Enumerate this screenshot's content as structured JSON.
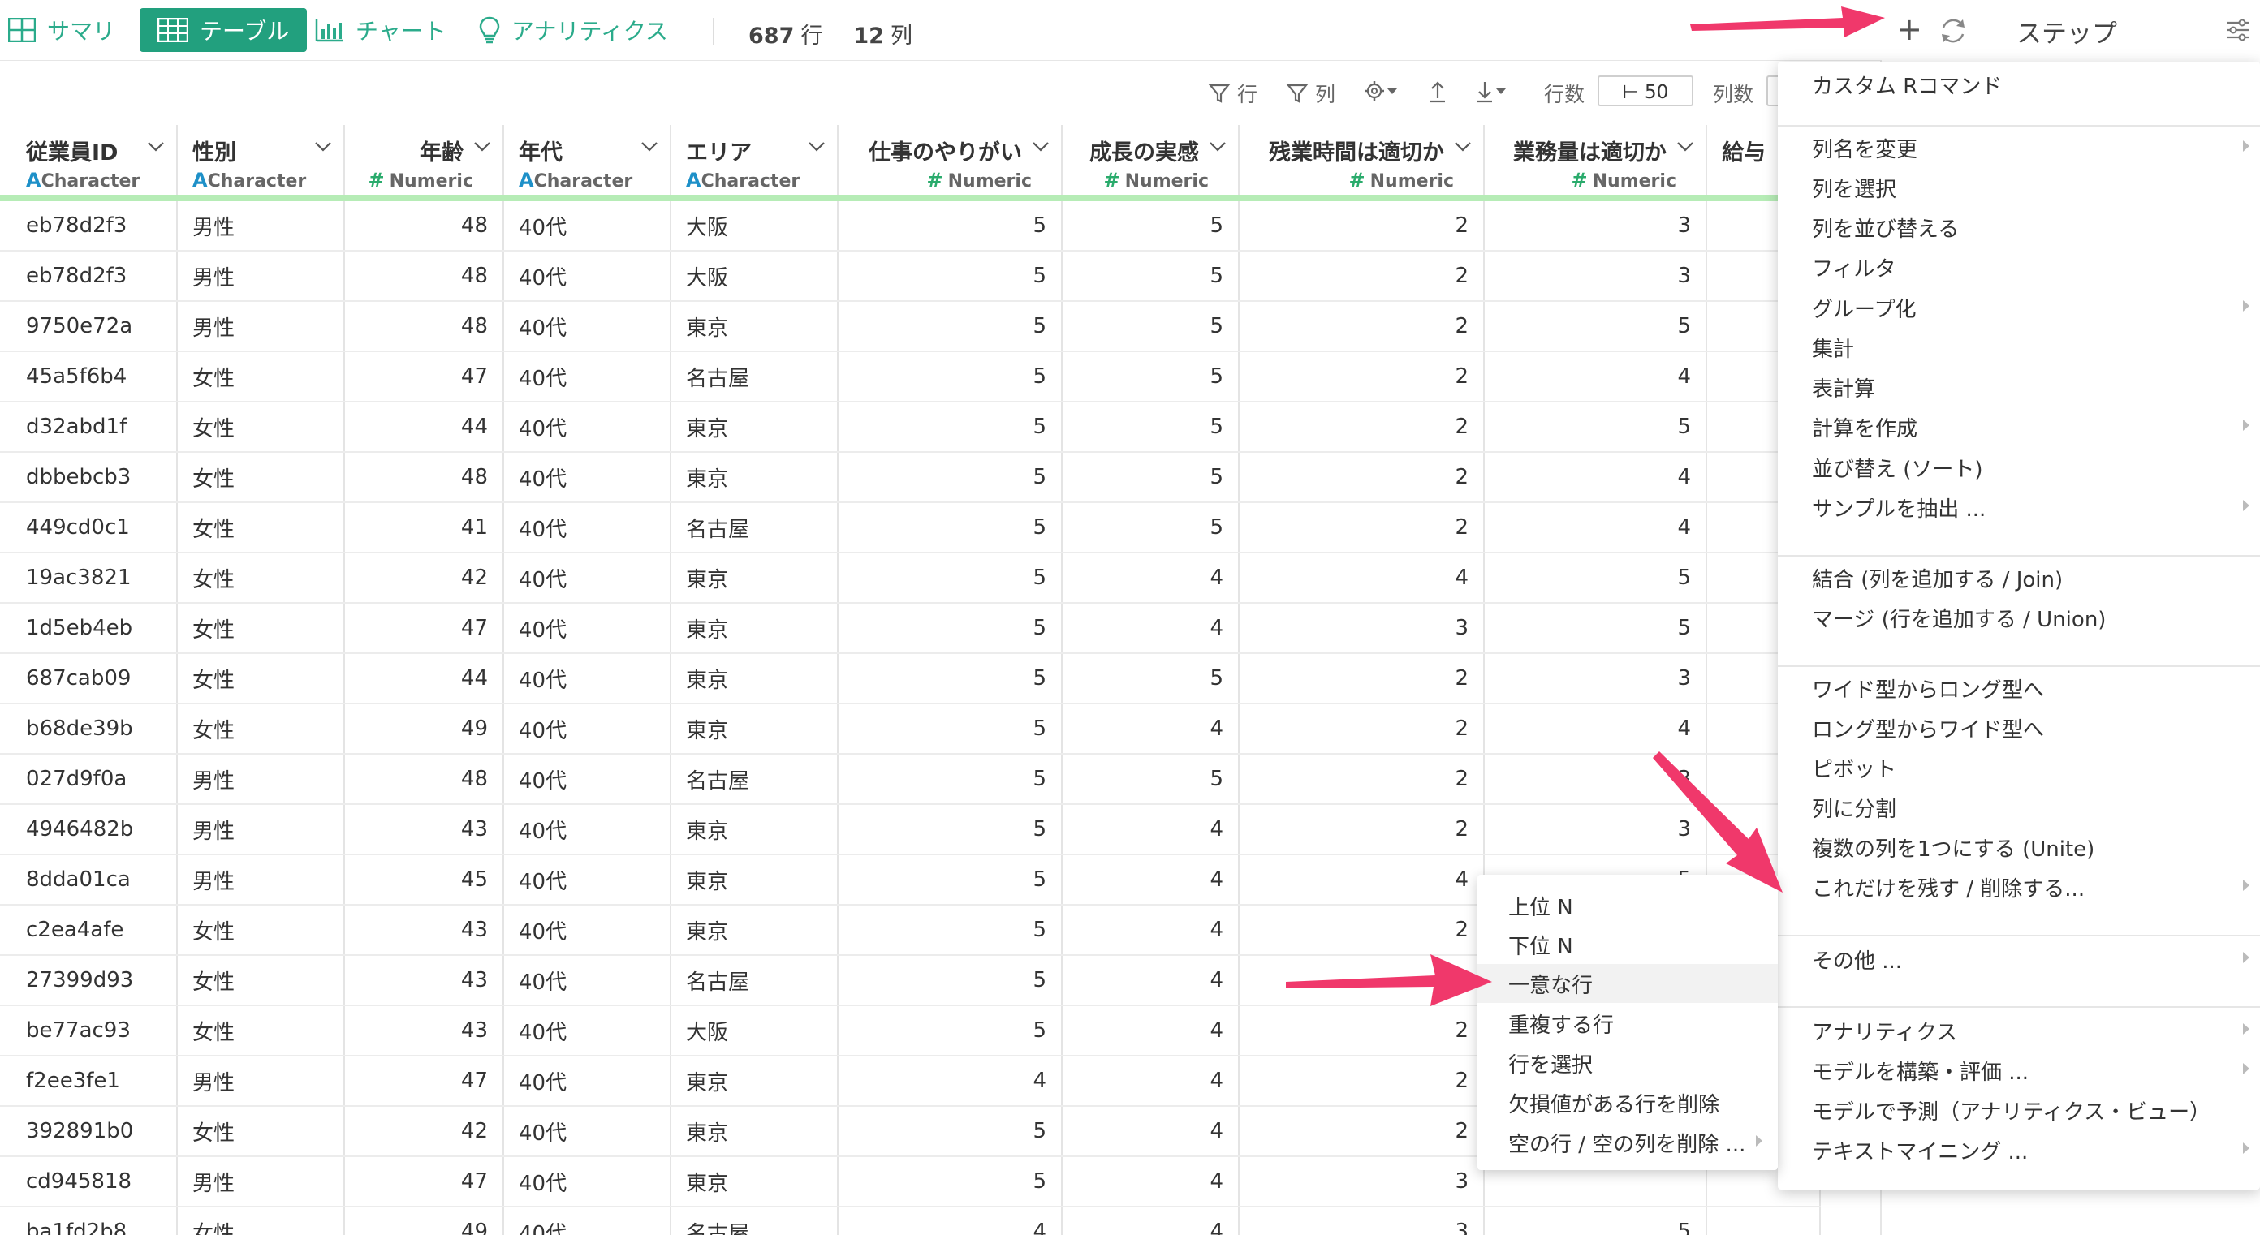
{
  "tabs": [
    {
      "label": "サマリ",
      "icon": "table-grid-icon"
    },
    {
      "label": "テーブル",
      "icon": "table-grid-icon",
      "active": true
    },
    {
      "label": "チャート",
      "icon": "bar-chart-icon"
    },
    {
      "label": "アナリティクス",
      "icon": "lightbulb-icon"
    }
  ],
  "counts": {
    "rows_value": "687",
    "rows_unit": "行",
    "cols_value": "12",
    "cols_unit": "列"
  },
  "steps_title": "ステップ",
  "toolbar2": {
    "filter_rows": "行",
    "filter_cols": "列",
    "rows_label": "行数",
    "rows_value": "⊢ 50",
    "cols_label": "列数"
  },
  "columns": [
    {
      "name": "従業員ID",
      "type_icon": "A",
      "type": "Character"
    },
    {
      "name": "性別",
      "type_icon": "A",
      "type": "Character"
    },
    {
      "name": "年齢",
      "type_icon": "#",
      "type": "Numeric"
    },
    {
      "name": "年代",
      "type_icon": "A",
      "type": "Character"
    },
    {
      "name": "エリア",
      "type_icon": "A",
      "type": "Character"
    },
    {
      "name": "仕事のやりがい",
      "type_icon": "#",
      "type": "Numeric"
    },
    {
      "name": "成長の実感",
      "type_icon": "#",
      "type": "Numeric"
    },
    {
      "name": "残業時間は適切か",
      "type_icon": "#",
      "type": "Numeric"
    },
    {
      "name": "業務量は適切か",
      "type_icon": "#",
      "type": "Numeric"
    },
    {
      "name": "給与",
      "type_icon": "",
      "type": ""
    }
  ],
  "rows": [
    [
      "eb78d2f3",
      "男性",
      "48",
      "40代",
      "大阪",
      "5",
      "5",
      "2",
      "3"
    ],
    [
      "eb78d2f3",
      "男性",
      "48",
      "40代",
      "大阪",
      "5",
      "5",
      "2",
      "3"
    ],
    [
      "9750e72a",
      "男性",
      "48",
      "40代",
      "東京",
      "5",
      "5",
      "2",
      "5"
    ],
    [
      "45a5f6b4",
      "女性",
      "47",
      "40代",
      "名古屋",
      "5",
      "5",
      "2",
      "4"
    ],
    [
      "d32abd1f",
      "女性",
      "44",
      "40代",
      "東京",
      "5",
      "5",
      "2",
      "5"
    ],
    [
      "dbbebcb3",
      "女性",
      "48",
      "40代",
      "東京",
      "5",
      "5",
      "2",
      "4"
    ],
    [
      "449cd0c1",
      "女性",
      "41",
      "40代",
      "名古屋",
      "5",
      "5",
      "2",
      "4"
    ],
    [
      "19ac3821",
      "女性",
      "42",
      "40代",
      "東京",
      "5",
      "4",
      "4",
      "5"
    ],
    [
      "1d5eb4eb",
      "女性",
      "47",
      "40代",
      "東京",
      "5",
      "4",
      "3",
      "5"
    ],
    [
      "687cab09",
      "女性",
      "44",
      "40代",
      "東京",
      "5",
      "5",
      "2",
      "3"
    ],
    [
      "b68de39b",
      "女性",
      "49",
      "40代",
      "東京",
      "5",
      "4",
      "2",
      "4"
    ],
    [
      "027d9f0a",
      "男性",
      "48",
      "40代",
      "名古屋",
      "5",
      "5",
      "2",
      "3"
    ],
    [
      "4946482b",
      "男性",
      "43",
      "40代",
      "東京",
      "5",
      "4",
      "2",
      "3"
    ],
    [
      "8dda01ca",
      "男性",
      "45",
      "40代",
      "東京",
      "5",
      "4",
      "4",
      "5"
    ],
    [
      "c2ea4afe",
      "女性",
      "43",
      "40代",
      "東京",
      "5",
      "4",
      "2",
      ""
    ],
    [
      "27399d93",
      "女性",
      "43",
      "40代",
      "名古屋",
      "5",
      "4",
      "2",
      ""
    ],
    [
      "be77ac93",
      "女性",
      "43",
      "40代",
      "大阪",
      "5",
      "4",
      "2",
      ""
    ],
    [
      "f2ee3fe1",
      "男性",
      "47",
      "40代",
      "東京",
      "4",
      "4",
      "2",
      ""
    ],
    [
      "392891b0",
      "女性",
      "42",
      "40代",
      "東京",
      "5",
      "4",
      "2",
      ""
    ],
    [
      "cd945818",
      "男性",
      "47",
      "40代",
      "東京",
      "5",
      "4",
      "3",
      ""
    ],
    [
      "ba1fd2b8",
      "女性",
      "49",
      "40代",
      "名古屋",
      "4",
      "4",
      "3",
      "5"
    ]
  ],
  "main_menu": {
    "items": [
      {
        "label": "カスタム Rコマンド",
        "arrow": false
      },
      {
        "label": "列名を変更",
        "arrow": true
      },
      {
        "label": "列を選択",
        "arrow": false
      },
      {
        "label": "列を並び替える",
        "arrow": false
      },
      {
        "label": "フィルタ",
        "arrow": false
      },
      {
        "label": "グループ化",
        "arrow": true
      },
      {
        "label": "集計",
        "arrow": false
      },
      {
        "label": "表計算",
        "arrow": false
      },
      {
        "label": "計算を作成",
        "arrow": true
      },
      {
        "label": "並び替え (ソート)",
        "arrow": false
      },
      {
        "label": "サンプルを抽出 ...",
        "arrow": true
      },
      {
        "label": "結合 (列を追加する / Join)",
        "arrow": false
      },
      {
        "label": "マージ (行を追加する / Union)",
        "arrow": false
      },
      {
        "label": "ワイド型からロング型へ",
        "arrow": false
      },
      {
        "label": "ロング型からワイド型へ",
        "arrow": false
      },
      {
        "label": "ピボット",
        "arrow": false
      },
      {
        "label": "列に分割",
        "arrow": false
      },
      {
        "label": "複数の列を1つにする (Unite)",
        "arrow": false
      },
      {
        "label": "これだけを残す / 削除する...",
        "arrow": true
      },
      {
        "label": "その他 ...",
        "arrow": true
      },
      {
        "label": "アナリティクス",
        "arrow": true
      },
      {
        "label": "モデルを構築・評価 ...",
        "arrow": true
      },
      {
        "label": "モデルで予測（アナリティクス・ビュー）",
        "arrow": false
      },
      {
        "label": "テキストマイニング ...",
        "arrow": true
      }
    ]
  },
  "sub_menu": {
    "items": [
      {
        "label": "上位 N"
      },
      {
        "label": "下位 N"
      },
      {
        "label": "一意な行",
        "highlighted": true
      },
      {
        "label": "重複する行"
      },
      {
        "label": "行を選択"
      },
      {
        "label": "欠損値がある行を削除"
      },
      {
        "label": "空の行 / 空の列を削除 ...",
        "arrow": true
      }
    ]
  },
  "colors": {
    "accent": "#22a07e",
    "arrow": "#f0386b",
    "header_underline": "#b6ecb6"
  }
}
